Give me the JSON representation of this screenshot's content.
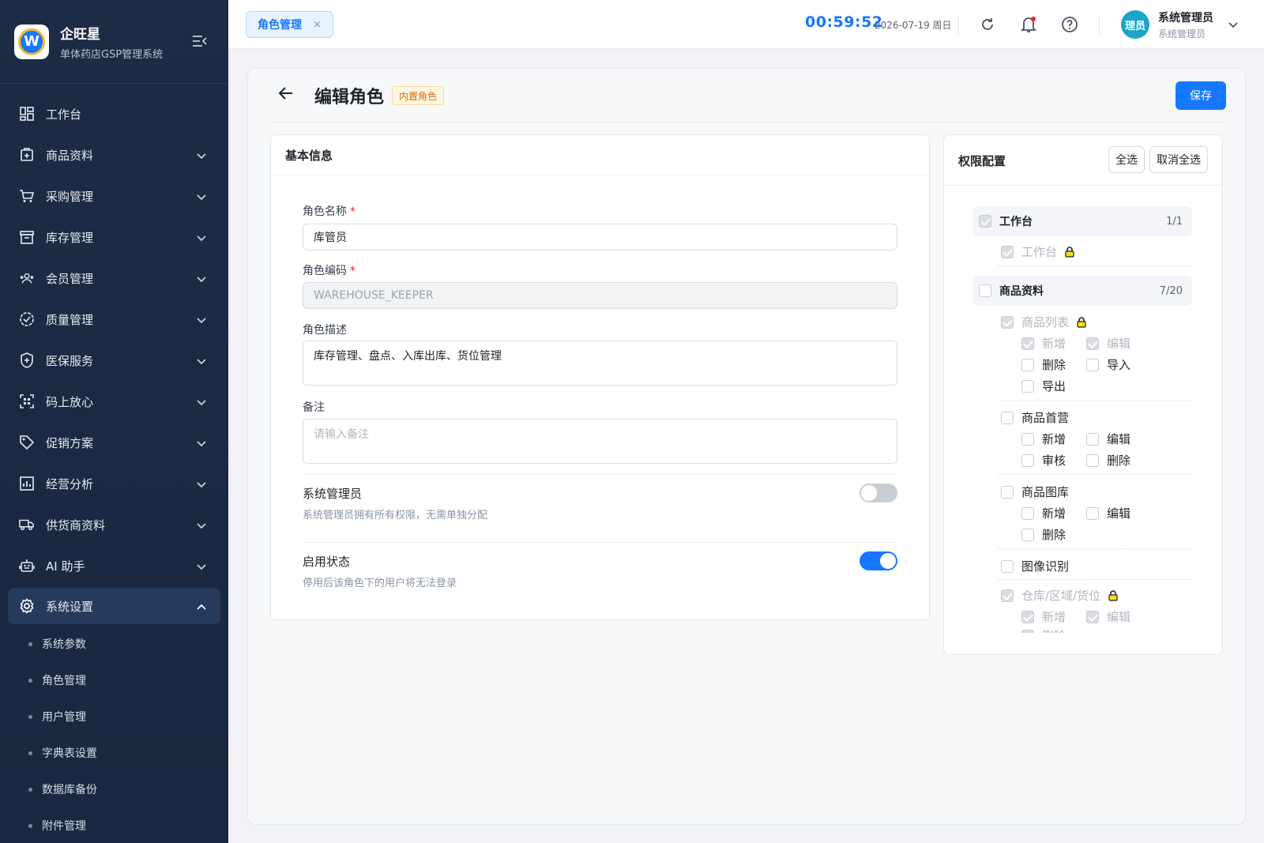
{
  "app": {
    "name": "企旺星",
    "subtitle": "单体药店GSP管理系统",
    "logo_letter": "W"
  },
  "sidebar": {
    "items": [
      {
        "label": "工作台",
        "icon": "dashboard-icon"
      },
      {
        "label": "商品资料",
        "icon": "box-icon"
      },
      {
        "label": "采购管理",
        "icon": "cart-icon"
      },
      {
        "label": "库存管理",
        "icon": "archive-icon"
      },
      {
        "label": "会员管理",
        "icon": "users-icon"
      },
      {
        "label": "质量管理",
        "icon": "badge-check-icon"
      },
      {
        "label": "医保服务",
        "icon": "shield-plus-icon"
      },
      {
        "label": "码上放心",
        "icon": "qrcode-icon"
      },
      {
        "label": "促销方案",
        "icon": "tag-icon"
      },
      {
        "label": "经营分析",
        "icon": "chart-icon"
      },
      {
        "label": "供货商资料",
        "icon": "truck-icon"
      },
      {
        "label": "AI 助手",
        "icon": "robot-icon"
      }
    ],
    "active": {
      "label": "系统设置",
      "icon": "gear-icon"
    },
    "sub_items": [
      "系统参数",
      "角色管理",
      "用户管理",
      "字典表设置",
      "数据库备份",
      "附件管理"
    ]
  },
  "topbar": {
    "tab_label": "角色管理",
    "tab_close": "×",
    "clock": "00:59:52",
    "date": "2026-07-19 周日",
    "avatar_text": "理员",
    "user_name": "系统管理员",
    "user_role": "系统管理员"
  },
  "page": {
    "title": "编辑角色",
    "badge": "内置角色",
    "save_label": "保存"
  },
  "basic": {
    "title": "基本信息",
    "name_label": "角色名称",
    "name_value": "库管员",
    "code_label": "角色编码",
    "code_value": "WAREHOUSE_KEEPER",
    "desc_label": "角色描述",
    "desc_value": "库存管理、盘点、入库出库、货位管理",
    "remark_label": "备注",
    "remark_placeholder": "请输入备注",
    "required_mark": "*",
    "admin_title": "系统管理员",
    "admin_desc": "系统管理员拥有所有权限，无需单独分配",
    "admin_on": false,
    "enable_title": "启用状态",
    "enable_desc": "停用后该角色下的用户将无法登录",
    "enable_on": true
  },
  "perm": {
    "title": "权限配置",
    "select_all": "全选",
    "deselect_all": "取消全选",
    "groups": [
      {
        "label": "工作台",
        "count": "1/1"
      },
      {
        "label": "商品资料",
        "count": "7/20"
      }
    ],
    "items": {
      "workbench": "工作台",
      "goods_list": "商品列表",
      "goods_first": "商品首营",
      "goods_gallery": "商品图库",
      "image_recog": "图像识别",
      "warehouse": "仓库/区域/货位"
    },
    "ops": {
      "add": "新增",
      "edit": "编辑",
      "delete": "删除",
      "import": "导入",
      "export": "导出",
      "audit": "审核"
    }
  }
}
